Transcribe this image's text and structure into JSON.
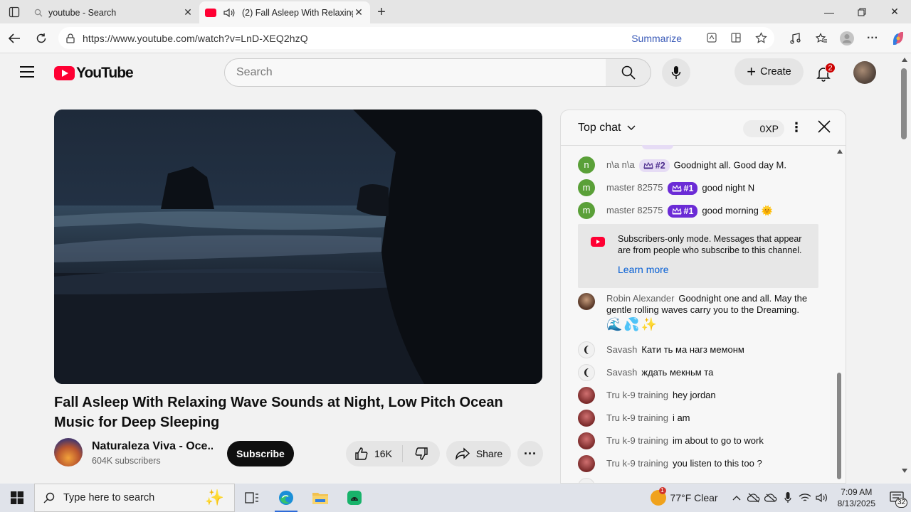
{
  "browser": {
    "tabs": [
      {
        "title": "youtube - Search",
        "active": false
      },
      {
        "title": "(2) Fall Asleep With Relaxing",
        "active": true
      }
    ],
    "url": "https://www.youtube.com/watch?v=LnD-XEQ2hzQ",
    "summarize_label": "Summarize"
  },
  "youtube": {
    "logo_text": "YouTube",
    "search_placeholder": "Search",
    "create_label": "Create",
    "notification_count": "2"
  },
  "video": {
    "title": "Fall Asleep With Relaxing Wave Sounds at Night, Low Pitch Ocean Music for Deep Sleeping",
    "channel_name": "Naturaleza Viva - Oce...",
    "subscribers": "604K subscribers",
    "subscribe_label": "Subscribe",
    "likes": "16K",
    "share_label": "Share"
  },
  "chat": {
    "header": "Top chat",
    "xp": "0XP",
    "messages": [
      {
        "avatar_letter": "n",
        "avatar_color": "#5aa038",
        "author": "n\\a n\\a",
        "rank": "#2",
        "text": "Goodnight all. Good day M."
      },
      {
        "avatar_letter": "m",
        "avatar_color": "#5aa038",
        "author": "master 82575",
        "rank": "#1",
        "text": "good night N"
      },
      {
        "avatar_letter": "m",
        "avatar_color": "#5aa038",
        "author": "master 82575",
        "rank": "#1",
        "text": "good morning 🌞"
      },
      {
        "author": "Robin Alexander",
        "text": "Goodnight one and all. May the gentle rolling waves carry you to the Dreaming.",
        "emojis": "🌊💦✨"
      },
      {
        "author": "Savash",
        "text": "Кати ть ма нагз мемонм"
      },
      {
        "author": "Savash",
        "text": "ждать мекньм та"
      },
      {
        "author": "Tru k-9 training",
        "text": "hey jordan"
      },
      {
        "author": "Tru k-9 training",
        "text": "i am"
      },
      {
        "author": "Tru k-9 training",
        "text": "im about to go to work"
      },
      {
        "author": "Tru k-9 training",
        "text": "you listen to this too ?"
      }
    ],
    "notice": {
      "text": "Subscribers-only mode. Messages that appear are from people who subscribe to this channel.",
      "link": "Learn more"
    }
  },
  "taskbar": {
    "search_placeholder": "Type here to search",
    "weather": "77°F  Clear",
    "time": "7:09 AM",
    "date": "8/13/2025",
    "notif_count": "32"
  }
}
